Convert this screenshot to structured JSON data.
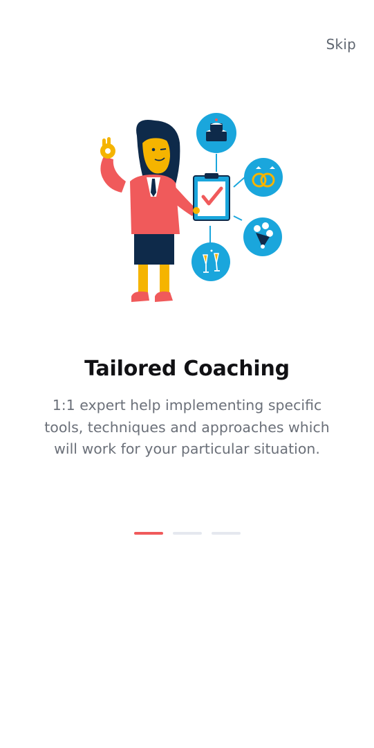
{
  "header": {
    "skip_label": "Skip"
  },
  "onboarding": {
    "title": "Tailored Coaching",
    "description": "1:1 expert help implementing specific tools, techniques and approaches which will work for your particular situation.",
    "page_indicator": {
      "total": 3,
      "active_index": 0
    }
  },
  "colors": {
    "accent": "#f05a5b",
    "indicator_inactive": "#e5e8ef",
    "icon_circle": "#1aa6dc",
    "title": "#111114",
    "body_text": "#6b7079"
  },
  "illustration": {
    "subject": "woman-with-checklist-icon",
    "icons": [
      "cake-icon",
      "rings-icon",
      "bouquet-icon",
      "champagne-icon",
      "clipboard-check-icon"
    ]
  }
}
